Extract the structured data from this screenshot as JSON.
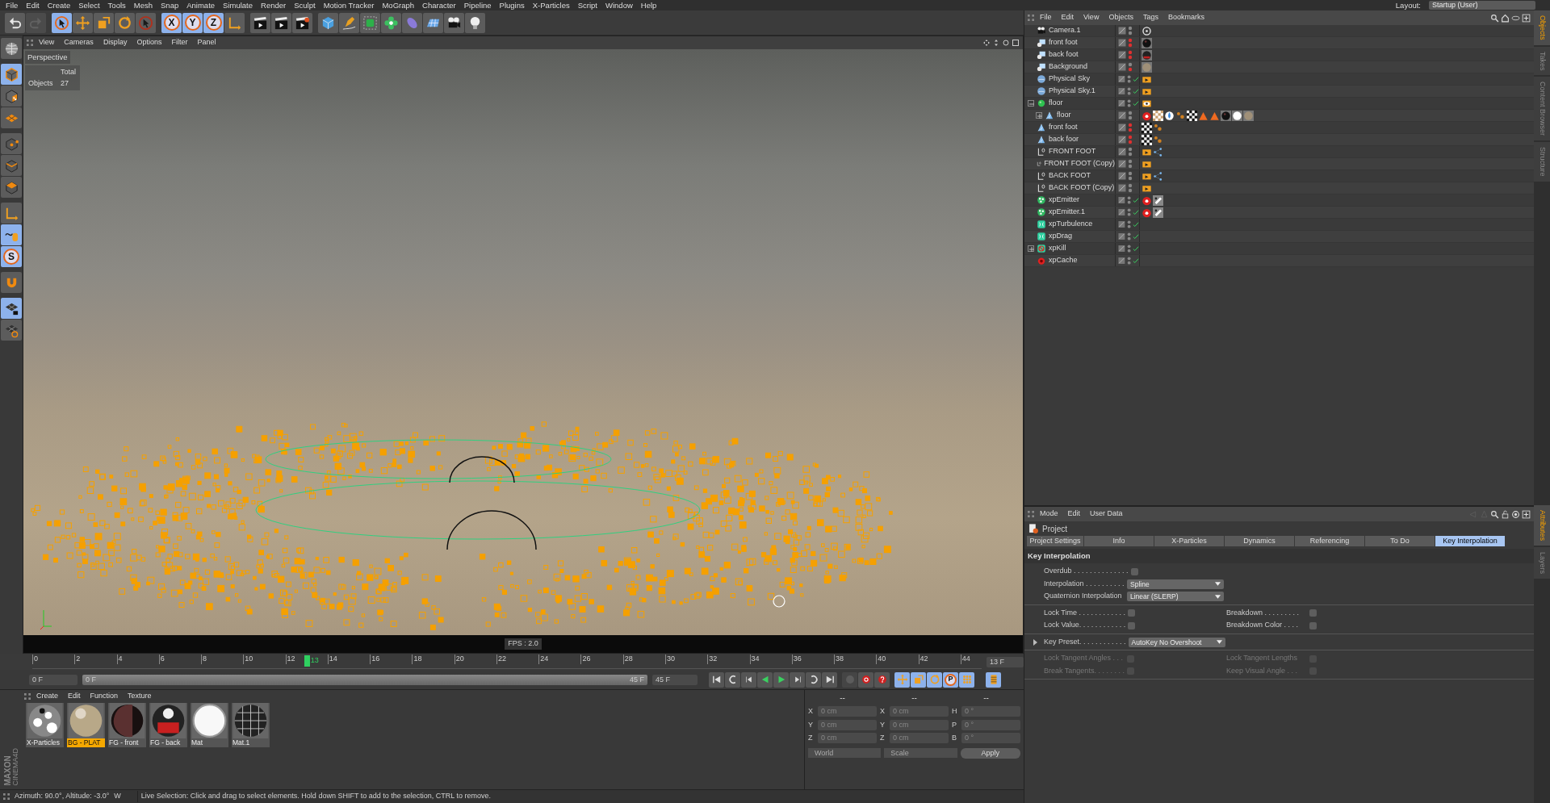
{
  "menu_bar": {
    "items": [
      "File",
      "Edit",
      "Create",
      "Select",
      "Tools",
      "Mesh",
      "Snap",
      "Animate",
      "Simulate",
      "Render",
      "Sculpt",
      "Motion Tracker",
      "MoGraph",
      "Character",
      "Pipeline",
      "Plugins",
      "X-Particles",
      "Script",
      "Window",
      "Help"
    ],
    "layout_label": "Layout:",
    "layout_value": "Startup (User)"
  },
  "toolbar": {
    "groups": [
      [
        {
          "kind": "undo",
          "selected": false,
          "disabled": false
        },
        {
          "kind": "redo",
          "selected": false,
          "disabled": true
        }
      ],
      [
        {
          "kind": "select",
          "selected": true,
          "disabled": false
        },
        {
          "kind": "move",
          "selected": false,
          "disabled": false
        },
        {
          "kind": "scale",
          "selected": false,
          "disabled": false
        },
        {
          "kind": "rotate",
          "selected": false,
          "disabled": false
        },
        {
          "kind": "recent",
          "selected": false,
          "disabled": false
        }
      ],
      [
        {
          "kind": "axis-lock",
          "label": "X",
          "selected": true,
          "disabled": false
        },
        {
          "kind": "axis-lock",
          "label": "Y",
          "selected": true,
          "disabled": false
        },
        {
          "kind": "axis-lock",
          "label": "Z",
          "selected": true,
          "disabled": false
        },
        {
          "kind": "coords",
          "selected": false,
          "disabled": false
        }
      ],
      [
        {
          "kind": "render",
          "selected": false,
          "disabled": false
        },
        {
          "kind": "render",
          "selected": false,
          "disabled": false
        },
        {
          "kind": "render-settings",
          "selected": false,
          "disabled": false
        }
      ],
      [
        {
          "kind": "cube",
          "selected": false,
          "disabled": false
        },
        {
          "kind": "pen",
          "selected": false,
          "disabled": false
        },
        {
          "kind": "subdiv",
          "selected": false,
          "disabled": false
        },
        {
          "kind": "cloner",
          "selected": false,
          "disabled": false
        },
        {
          "kind": "bend",
          "selected": false,
          "disabled": false
        },
        {
          "kind": "floor",
          "selected": false,
          "disabled": false
        },
        {
          "kind": "camera",
          "selected": false,
          "disabled": false
        },
        {
          "kind": "light",
          "selected": false,
          "disabled": false
        }
      ]
    ]
  },
  "mode_bar": {
    "groups": [
      [
        {
          "kind": "globe",
          "selected": false
        }
      ],
      [
        {
          "kind": "model",
          "selected": true
        },
        {
          "kind": "texture",
          "selected": false
        },
        {
          "kind": "workplane",
          "selected": false
        }
      ],
      [
        {
          "kind": "points",
          "selected": false
        },
        {
          "kind": "edges",
          "selected": false
        },
        {
          "kind": "polygons",
          "selected": false
        }
      ],
      [
        {
          "kind": "coords",
          "selected": false
        },
        {
          "kind": "tweak",
          "selected": true
        },
        {
          "kind": "snap",
          "label": "S",
          "selected": true
        }
      ],
      [
        {
          "kind": "magnet",
          "selected": false
        }
      ],
      [
        {
          "kind": "lockgrid",
          "selected": true
        },
        {
          "kind": "rotgrid",
          "selected": false
        }
      ]
    ]
  },
  "viewport": {
    "menu": [
      "View",
      "Cameras",
      "Display",
      "Options",
      "Filter",
      "Panel"
    ],
    "camera": "Perspective",
    "stats": {
      "header": "Total",
      "label": "Objects",
      "value": "27"
    },
    "fps": "FPS : 2.0"
  },
  "timeline": {
    "ticks": [
      "0",
      "2",
      "4",
      "6",
      "8",
      "10",
      "12",
      "14",
      "16",
      "18",
      "20",
      "22",
      "24",
      "26",
      "28",
      "30",
      "32",
      "34",
      "36",
      "38",
      "40",
      "42",
      "44"
    ],
    "playhead": {
      "label": "13",
      "level": 0.289
    },
    "frame": "13 F",
    "start": "0 F",
    "range": {
      "start": "0 F",
      "end": "45 F",
      "level": 1
    },
    "end": "45 F",
    "transport": [
      {
        "kind": "first"
      },
      {
        "kind": "prevkey"
      },
      {
        "kind": "prevframe"
      },
      {
        "kind": "playback"
      },
      {
        "kind": "play"
      },
      {
        "kind": "nextframe"
      },
      {
        "kind": "nextkey"
      },
      {
        "kind": "last"
      }
    ],
    "record_tools": [
      {
        "kind": "record",
        "disabled": true
      },
      {
        "kind": "autokey",
        "disabled": false
      },
      {
        "kind": "keyhelp",
        "disabled": false
      }
    ],
    "key_tools": [
      {
        "kind": "move",
        "selected": true
      },
      {
        "kind": "scale",
        "selected": true
      },
      {
        "kind": "rotate",
        "selected": true
      },
      {
        "kind": "param",
        "label": "P",
        "selected": true
      },
      {
        "kind": "pla",
        "selected": true
      }
    ]
  },
  "material_manager": {
    "menu": [
      "Create",
      "Edit",
      "Function",
      "Texture"
    ],
    "logo": {
      "brand": "MAXON",
      "product": "CINEMA4D"
    },
    "materials": [
      {
        "name": "X-Particles",
        "kind": "dots",
        "selected": false
      },
      {
        "name": "BG - PLAT",
        "kind": "plate",
        "selected": true
      },
      {
        "name": "FG - front",
        "kind": "dark",
        "selected": false
      },
      {
        "name": "FG - back",
        "kind": "red",
        "selected": false
      },
      {
        "name": "Mat",
        "kind": "white",
        "selected": false
      },
      {
        "name": "Mat.1",
        "kind": "wire",
        "selected": false
      }
    ]
  },
  "coordinates": {
    "headers": [
      "--",
      "--",
      "--"
    ],
    "rows": [
      {
        "pos_axis": "X",
        "pos": "0 cm",
        "size_axis": "X",
        "size": "0 cm",
        "rot_axis": "H",
        "rot": "0 °"
      },
      {
        "pos_axis": "Y",
        "pos": "0 cm",
        "size_axis": "Y",
        "size": "0 cm",
        "rot_axis": "P",
        "rot": "0 °"
      },
      {
        "pos_axis": "Z",
        "pos": "0 cm",
        "size_axis": "Z",
        "size": "0 cm",
        "rot_axis": "B",
        "rot": "0 °"
      }
    ],
    "space": "World",
    "mode": "Scale",
    "apply": "Apply"
  },
  "status_bar": {
    "view_info": "Azimuth: 90.0°, Altitude: -3.0°",
    "direction": "W",
    "message": "Live Selection: Click and drag to select elements. Hold down SHIFT to add to the selection, CTRL to remove."
  },
  "object_manager": {
    "menu": [
      "File",
      "Edit",
      "View",
      "Objects",
      "Tags",
      "Bookmarks"
    ],
    "objects": [
      {
        "name": "Camera.1",
        "kind": "camera",
        "editor_hidden": false,
        "render_hidden": false,
        "checked": false,
        "tags": [
          {
            "kind": "target"
          }
        ]
      },
      {
        "name": "front foot",
        "kind": "background",
        "editor_hidden": true,
        "render_hidden": true,
        "checked": false,
        "tags": [
          {
            "kind": "material-dark"
          }
        ]
      },
      {
        "name": "back foot",
        "kind": "background",
        "editor_hidden": true,
        "render_hidden": true,
        "checked": false,
        "tags": [
          {
            "kind": "material-red"
          }
        ]
      },
      {
        "name": "Background",
        "kind": "background",
        "editor_hidden": false,
        "render_hidden": true,
        "checked": false,
        "tags": [
          {
            "kind": "material-plate"
          }
        ]
      },
      {
        "name": "Physical Sky",
        "kind": "sky",
        "editor_hidden": false,
        "render_hidden": false,
        "checked": true,
        "tags": [
          {
            "kind": "compositing"
          }
        ]
      },
      {
        "name": "Physical Sky.1",
        "kind": "sky",
        "editor_hidden": false,
        "render_hidden": false,
        "checked": true,
        "tags": [
          {
            "kind": "compositing"
          }
        ]
      },
      {
        "name": "floor",
        "kind": "sphere",
        "editor_hidden": false,
        "render_hidden": false,
        "checked": true,
        "tags": [
          {
            "kind": "display"
          }
        ],
        "expanded": true,
        "children": [
          {
            "name": "floor",
            "kind": "polygon",
            "editor_hidden": false,
            "render_hidden": false,
            "checked": false,
            "expanded": false,
            "tags": [
              {
                "kind": "xp-material"
              },
              {
                "kind": "checker-brown"
              },
              {
                "kind": "texture"
              },
              {
                "kind": "particles"
              },
              {
                "kind": "checker"
              },
              {
                "kind": "warning"
              },
              {
                "kind": "warning"
              },
              {
                "kind": "material-dark"
              },
              {
                "kind": "material-white"
              },
              {
                "kind": "material-plate"
              }
            ]
          }
        ]
      },
      {
        "name": "front foot",
        "kind": "polygon",
        "editor_hidden": true,
        "render_hidden": true,
        "checked": false,
        "tags": [
          {
            "kind": "checker"
          },
          {
            "kind": "particles"
          }
        ]
      },
      {
        "name": "back foor",
        "kind": "polygon",
        "editor_hidden": true,
        "render_hidden": true,
        "checked": false,
        "tags": [
          {
            "kind": "checker"
          },
          {
            "kind": "particles"
          }
        ]
      },
      {
        "name": "FRONT FOOT",
        "kind": "null",
        "editor_hidden": false,
        "render_hidden": false,
        "checked": false,
        "tags": [
          {
            "kind": "compositing"
          },
          {
            "kind": "connector"
          }
        ]
      },
      {
        "name": "FRONT FOOT (Copy)",
        "kind": "null",
        "editor_hidden": false,
        "render_hidden": false,
        "checked": false,
        "tags": [
          {
            "kind": "compositing"
          }
        ]
      },
      {
        "name": "BACK FOOT",
        "kind": "null",
        "editor_hidden": false,
        "render_hidden": false,
        "checked": false,
        "tags": [
          {
            "kind": "compositing"
          },
          {
            "kind": "connector"
          }
        ]
      },
      {
        "name": "BACK FOOT (Copy)",
        "kind": "null",
        "editor_hidden": false,
        "render_hidden": false,
        "checked": false,
        "tags": [
          {
            "kind": "compositing"
          }
        ]
      },
      {
        "name": "xpEmitter",
        "kind": "emitter",
        "editor_hidden": false,
        "render_hidden": false,
        "checked": true,
        "tags": [
          {
            "kind": "xp-material"
          },
          {
            "kind": "checker-grey"
          }
        ]
      },
      {
        "name": "xpEmitter.1",
        "kind": "emitter",
        "editor_hidden": false,
        "render_hidden": false,
        "checked": true,
        "tags": [
          {
            "kind": "xp-material"
          },
          {
            "kind": "checker-grey"
          }
        ]
      },
      {
        "name": "xpTurbulence",
        "kind": "modifier",
        "editor_hidden": false,
        "render_hidden": false,
        "checked": true
      },
      {
        "name": "xpDrag",
        "kind": "modifier",
        "editor_hidden": false,
        "render_hidden": false,
        "checked": true
      },
      {
        "name": "xpKill",
        "kind": "kill",
        "editor_hidden": false,
        "render_hidden": false,
        "checked": true,
        "expanded": false
      },
      {
        "name": "xpCache",
        "kind": "cache",
        "editor_hidden": false,
        "render_hidden": false,
        "checked": true
      }
    ]
  },
  "attributes": {
    "menu": [
      "Mode",
      "Edit",
      "User Data"
    ],
    "title": "Project",
    "tabs": [
      {
        "label": "Project Settings",
        "selected": false
      },
      {
        "label": "Info",
        "selected": false
      },
      {
        "label": "X-Particles",
        "selected": false
      },
      {
        "label": "Dynamics",
        "selected": false
      },
      {
        "label": "Referencing",
        "selected": false
      },
      {
        "label": "To Do",
        "selected": false
      },
      {
        "label": "Key Interpolation",
        "selected": true
      }
    ],
    "section": "Key Interpolation",
    "groups": [
      [
        [
          {
            "kind": "checkbox",
            "label": "Overdub . . . . . . . . . . . . . .",
            "checked": false,
            "disabled": false
          }
        ],
        [
          {
            "kind": "dropdown",
            "label": "Interpolation . . . . . . . . . .",
            "value": "Spline",
            "disabled": false
          }
        ],
        [
          {
            "kind": "dropdown",
            "label": "Quaternion Interpolation",
            "value": "Linear (SLERP)",
            "disabled": false
          }
        ]
      ],
      [
        [
          {
            "kind": "checkbox",
            "label": "Lock Time . . . . . . . . . . . .",
            "checked": false,
            "disabled": false
          },
          {
            "kind": "checkbox",
            "label": "Breakdown . . . . . . . . .",
            "checked": false,
            "disabled": false
          }
        ],
        [
          {
            "kind": "checkbox",
            "label": "Lock Value. . . . . . . . . . . .",
            "checked": false,
            "disabled": false
          },
          {
            "kind": "checkbox",
            "label": "Breakdown Color . . . .",
            "checked": false,
            "disabled": false
          }
        ]
      ],
      [
        [
          {
            "kind": "preset",
            "label": "Key Preset. . . . . . . . . . . .",
            "value": "AutoKey No Overshoot",
            "disabled": false
          }
        ]
      ],
      [
        [
          {
            "kind": "checkbox",
            "label": "Lock Tangent Angles . . .",
            "checked": false,
            "disabled": true
          },
          {
            "kind": "checkbox",
            "label": "Lock Tangent Lengths",
            "checked": false,
            "disabled": true
          }
        ],
        [
          {
            "kind": "checkbox",
            "label": "Break Tangents. . . . . . . .",
            "checked": false,
            "disabled": true
          },
          {
            "kind": "checkbox",
            "label": "Keep Visual Angle . . .",
            "checked": false,
            "disabled": true
          }
        ]
      ]
    ]
  },
  "side_tabs_top": [
    {
      "label": "Objects",
      "selected": true
    },
    {
      "label": "Takes",
      "selected": false
    },
    {
      "label": "Content Browser",
      "selected": false
    },
    {
      "label": "Structure",
      "selected": false
    }
  ],
  "side_tabs_bottom": [
    {
      "label": "Attributes",
      "selected": true
    },
    {
      "label": "Layers",
      "selected": false
    }
  ]
}
